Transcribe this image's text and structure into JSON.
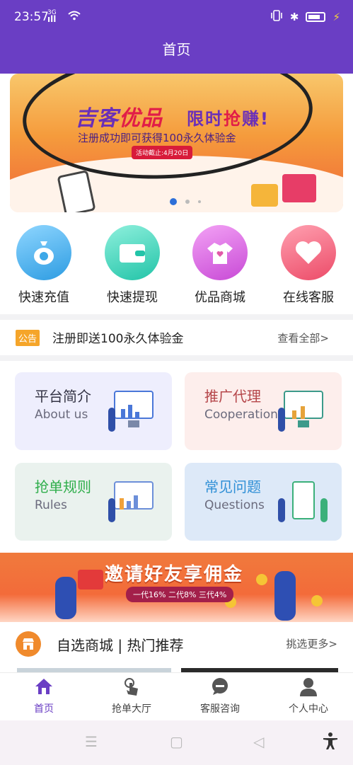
{
  "status_bar": {
    "time": "23:57",
    "network": "3G",
    "network_bars": "ıll",
    "wifi_icon": "wifi-icon",
    "vibrate_icon": "vibrate-icon",
    "bluetooth": "✱",
    "charging": "⚡"
  },
  "header": {
    "title": "首页"
  },
  "banner": {
    "brand_part1": "吉客",
    "brand_part2": "优品",
    "slogan_part1": "限时",
    "slogan_part2": "抢",
    "slogan_part3": "赚!",
    "subtitle": "注册成功即可获得100永久体验金",
    "deadline": "活动截止:4月20日",
    "active_slide": 1,
    "slide_count": 3
  },
  "quick_actions": [
    {
      "label": "快速充值",
      "icon": "money-bag-icon",
      "color": "#3da8e8"
    },
    {
      "label": "快速提现",
      "icon": "wallet-icon",
      "color": "#2ecbb3"
    },
    {
      "label": "优品商城",
      "icon": "shirt-icon",
      "color": "#d65ad8"
    },
    {
      "label": "在线客服",
      "icon": "heart-icon",
      "color": "#ef4d6a"
    }
  ],
  "notice": {
    "tag": "公告",
    "text": "注册即送100永久体验金",
    "more": "查看全部>"
  },
  "cards": [
    {
      "title": "平台简介",
      "subtitle": "About us",
      "bg": "#eeeefd",
      "title_color": "#333344"
    },
    {
      "title": "推广代理",
      "subtitle": "Cooperation",
      "bg": "#fdeeec",
      "title_color": "#b5464a"
    },
    {
      "title": "抢单规则",
      "subtitle": "Rules",
      "bg": "#eaf2ee",
      "title_color": "#2fae4b"
    },
    {
      "title": "常见问题",
      "subtitle": "Questions",
      "bg": "#dde9f8",
      "title_color": "#2f8fd6"
    }
  ],
  "promo": {
    "title": "邀请好友享佣金",
    "tiers": "一代16% 二代8% 三代4%"
  },
  "mall": {
    "title": "自选商城 | 热门推荐",
    "more": "挑选更多>"
  },
  "tabs": [
    {
      "label": "首页",
      "icon": "home-icon",
      "active": true
    },
    {
      "label": "抢单大厅",
      "icon": "tap-hand-icon",
      "active": false
    },
    {
      "label": "客服咨询",
      "icon": "chat-bubble-icon",
      "active": false
    },
    {
      "label": "个人中心",
      "icon": "person-icon",
      "active": false
    }
  ],
  "system_nav": {
    "menu": "☰",
    "home": "▢",
    "back": "◁",
    "accessibility": "accessibility-icon"
  }
}
